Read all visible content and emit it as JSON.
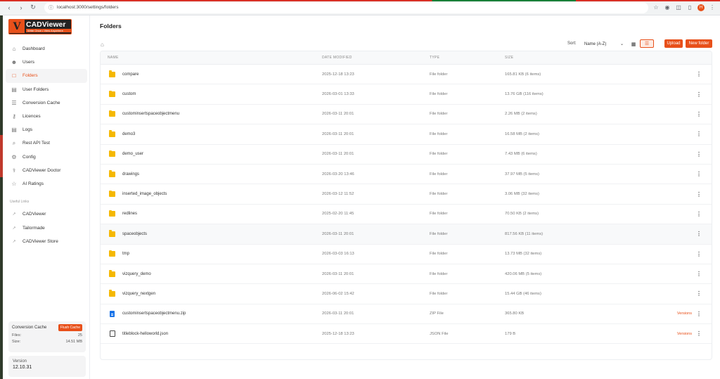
{
  "browser": {
    "url": "localhost:3000/settings/folders",
    "profile_initial": "H"
  },
  "brand": {
    "name": "CADViewer",
    "mark": "V",
    "tagline": "Write Once • View Anywhere",
    "accent": "#e8501a"
  },
  "sidebar": {
    "items": [
      {
        "label": "Dashboard",
        "icon": "home-icon"
      },
      {
        "label": "Users",
        "icon": "users-icon"
      },
      {
        "label": "Folders",
        "icon": "folder-icon",
        "active": true
      },
      {
        "label": "User Folders",
        "icon": "user-folder-icon"
      },
      {
        "label": "Conversion Cache",
        "icon": "database-icon"
      },
      {
        "label": "Licences",
        "icon": "key-icon"
      },
      {
        "label": "Logs",
        "icon": "logs-icon"
      },
      {
        "label": "Rest API Test",
        "icon": "code-icon"
      },
      {
        "label": "Config",
        "icon": "gear-icon"
      },
      {
        "label": "CADViewer Doctor",
        "icon": "stethoscope-icon"
      },
      {
        "label": "AI Ratings",
        "icon": "star-icon"
      }
    ],
    "useful_links_title": "Useful Links",
    "links": [
      {
        "label": "CADViewer",
        "icon": "external-link-icon"
      },
      {
        "label": "Tailormade",
        "icon": "external-link-icon"
      },
      {
        "label": "CADViewer Store",
        "icon": "external-link-icon"
      }
    ],
    "cache": {
      "title": "Conversion Cache",
      "flush_label": "Flush Cache",
      "files_label": "Files:",
      "files_value": "25",
      "size_label": "Size:",
      "size_value": "14.51 MB"
    },
    "version": {
      "label": "Version",
      "value": "12.10.31"
    }
  },
  "main": {
    "title": "Folders",
    "sort_label": "Sort:",
    "sort_value": "Name (A-Z)",
    "upload_label": "Upload",
    "new_folder_label": "New folder",
    "columns": {
      "name": "NAME",
      "date": "DATE MODIFIED",
      "type": "TYPE",
      "size": "SIZE"
    },
    "rows": [
      {
        "name": "compare",
        "date": "2025-12-18 13:23",
        "type": "File folder",
        "size": "165.81 KB (6 items)",
        "kind": "folder"
      },
      {
        "name": "custom",
        "date": "2026-03-01 13:33",
        "type": "File folder",
        "size": "13.76 GB (116 items)",
        "kind": "folder"
      },
      {
        "name": "custominsertspaceobjectmenu",
        "date": "2026-03-11 20:01",
        "type": "File folder",
        "size": "2.26 MB (2 items)",
        "kind": "folder"
      },
      {
        "name": "demo3",
        "date": "2026-03-11 20:01",
        "type": "File folder",
        "size": "16.58 MB (2 items)",
        "kind": "folder"
      },
      {
        "name": "demo_user",
        "date": "2026-03-11 20:01",
        "type": "File folder",
        "size": "7.43 MB (6 items)",
        "kind": "folder"
      },
      {
        "name": "drawings",
        "date": "2026-03-20 13:46",
        "type": "File folder",
        "size": "37.97 MB (5 items)",
        "kind": "folder"
      },
      {
        "name": "inserted_image_objects",
        "date": "2026-03-12 11:52",
        "type": "File folder",
        "size": "3.06 MB (32 items)",
        "kind": "folder"
      },
      {
        "name": "redlines",
        "date": "2025-02-20 11:45",
        "type": "File folder",
        "size": "70.50 KB (2 items)",
        "kind": "folder"
      },
      {
        "name": "spaceobjects",
        "date": "2026-03-11 20:01",
        "type": "File folder",
        "size": "817.56 KB (11 items)",
        "kind": "folder",
        "highlight": true
      },
      {
        "name": "tmp",
        "date": "2026-03-03 16:13",
        "type": "File folder",
        "size": "13.73 MB (32 items)",
        "kind": "folder"
      },
      {
        "name": "vizquery_demo",
        "date": "2026-03-11 20:01",
        "type": "File folder",
        "size": "420.06 MB (5 items)",
        "kind": "folder"
      },
      {
        "name": "vizquery_nextgen",
        "date": "2026-06-02 15:42",
        "type": "File folder",
        "size": "15.44 GB (46 items)",
        "kind": "folder"
      },
      {
        "name": "custominsertspaceobjectmenu.zip",
        "date": "2026-03-11 20:01",
        "type": "ZIP File",
        "size": "365.80 KB",
        "kind": "zip",
        "versions": "Versions"
      },
      {
        "name": "titleblock-helloworld.json",
        "date": "2025-12-18 13:23",
        "type": "JSON File",
        "size": "179 B",
        "kind": "json",
        "versions": "Versions"
      }
    ]
  }
}
